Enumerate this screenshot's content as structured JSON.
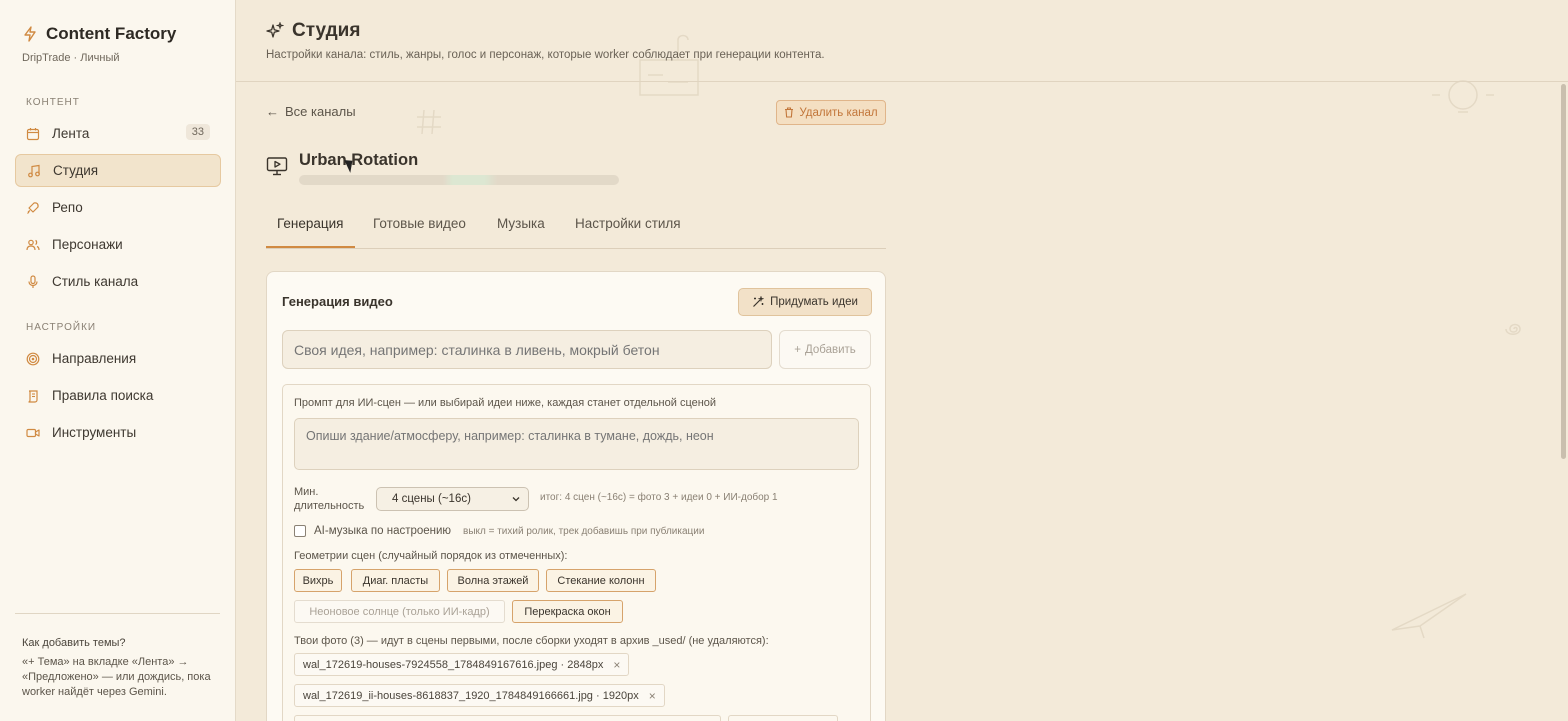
{
  "sidebar": {
    "brand_title": "Content Factory",
    "brand_subtitle": "DripTrade · Личный",
    "section_content": "КОНТЕНТ",
    "section_settings": "НАСТРОЙКИ",
    "items": [
      {
        "label": "Лента",
        "icon": "calendar-icon",
        "badge": "33"
      },
      {
        "label": "Студия",
        "icon": "music-note-icon",
        "active": true
      },
      {
        "label": "Репо",
        "icon": "rocket-icon"
      },
      {
        "label": "Персонажи",
        "icon": "users-icon"
      },
      {
        "label": "Стиль канала",
        "icon": "microphone-icon"
      },
      {
        "label": "Направления",
        "icon": "target-icon"
      },
      {
        "label": "Правила поиска",
        "icon": "scroll-icon"
      },
      {
        "label": "Инструменты",
        "icon": "video-camera-icon"
      }
    ],
    "help_title": "Как добавить темы?",
    "help_text": "«+ Тема» на вкладке «Лента» → «Предложено» — или дождись, пока worker найдёт через Gemini."
  },
  "header": {
    "title": "Студия",
    "subtitle": "Настройки канала: стиль, жанры, голос и персонаж, которые worker соблюдает при генерации контента."
  },
  "channel": {
    "back_label": "Все каналы",
    "delete_label": "Удалить канал",
    "name": "Urban Rotation"
  },
  "tabs": [
    {
      "label": "Генерация",
      "active": true
    },
    {
      "label": "Готовые видео"
    },
    {
      "label": "Музыка"
    },
    {
      "label": "Настройки стиля"
    }
  ],
  "generation": {
    "title": "Генерация видео",
    "ideas_button": "Придумать идеи",
    "idea_placeholder": "Своя идея, например: сталинка в ливень, мокрый бетон",
    "add_button": "Добавить",
    "prompt_label": "Промпт для ИИ-сцен — или выбирай идеи ниже, каждая станет отдельной сценой",
    "prompt_placeholder": "Опиши здание/атмосферу, например: сталинка в тумане, дождь, неон",
    "duration_label": "Мин. длительность",
    "duration_value": "4 сцены (~16с)",
    "duration_summary": "итог: 4 сцен (~16с) = фото 3 + идеи 0 + ИИ-добор 1",
    "music_label": "AI-музыка по настроению",
    "music_hint": "выкл = тихий ролик, трек добавишь при публикации",
    "geometry_label": "Геометрии сцен (случайный порядок из отмеченных):",
    "geometries": [
      {
        "label": "Вихрь",
        "selected": true
      },
      {
        "label": "Диаг. пласты",
        "selected": true
      },
      {
        "label": "Волна этажей",
        "selected": true
      },
      {
        "label": "Стекание колонн",
        "selected": true
      },
      {
        "label": "Неоновое солнце (только ИИ-кадр)",
        "selected": false
      },
      {
        "label": "Перекраска окон",
        "selected": true
      }
    ],
    "photos_label": "Твои фото (3) — идут в сцены первыми, после сборки уходят в архив _used/ (не удаляются):",
    "photos": [
      {
        "name": "wal_172619-houses-7924558_1784849167616.jpeg · 2848px"
      },
      {
        "name": "wal_172619_ii-houses-8618837_1920_1784849166661.jpg · 1920px"
      }
    ]
  },
  "colors": {
    "accent": "#d08a42",
    "background": "#f3ead9",
    "sidebar": "#fbf7ee"
  }
}
